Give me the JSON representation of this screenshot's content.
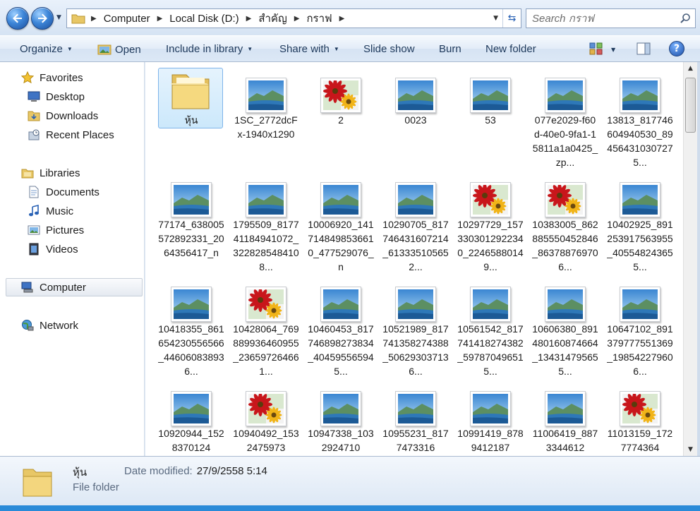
{
  "navigation": {
    "breadcrumbs": [
      "Computer",
      "Local Disk (D:)",
      "สำคัญ",
      "กราฟ"
    ],
    "search_placeholder": "Search กราฟ"
  },
  "toolbar": {
    "organize": "Organize",
    "open": "Open",
    "include_in_library": "Include in library",
    "share_with": "Share with",
    "slide_show": "Slide show",
    "burn": "Burn",
    "new_folder": "New folder",
    "help": "?"
  },
  "sidebar": {
    "favorites": "Favorites",
    "desktop": "Desktop",
    "downloads": "Downloads",
    "recent_places": "Recent Places",
    "libraries": "Libraries",
    "documents": "Documents",
    "music": "Music",
    "pictures": "Pictures",
    "videos": "Videos",
    "computer": "Computer",
    "network": "Network"
  },
  "files": [
    {
      "label": "หุ้น",
      "kind": "folder",
      "selected": true
    },
    {
      "label": "1SC_2772dcFx-1940x1290",
      "kind": "landscape"
    },
    {
      "label": "2",
      "kind": "flower"
    },
    {
      "label": "0023",
      "kind": "landscape"
    },
    {
      "label": "53",
      "kind": "landscape"
    },
    {
      "label": "077e2029-f60d-40e0-9fa1-15811a1a0425_zp...",
      "kind": "landscape"
    },
    {
      "label": "13813_817746604940530_894564310307275...",
      "kind": "landscape"
    },
    {
      "label": "77174_638005572892331_2064356417_n",
      "kind": "landscape"
    },
    {
      "label": "1795509_817741184941072_3228285484108...",
      "kind": "landscape"
    },
    {
      "label": "10006920_1417148498536610_477529076_n",
      "kind": "landscape"
    },
    {
      "label": "10290705_817746431607214_613335105652...",
      "kind": "landscape"
    },
    {
      "label": "10297729_1573303012922340_22465880149...",
      "kind": "flower"
    },
    {
      "label": "10383005_862885550452846_863788769706...",
      "kind": "flower"
    },
    {
      "label": "10402925_891253917563955_405548243655...",
      "kind": "landscape"
    },
    {
      "label": "10418355_861654230556566_446060838936...",
      "kind": "landscape"
    },
    {
      "label": "10428064_769889936460955_236597264661...",
      "kind": "flower"
    },
    {
      "label": "10460453_817746898273834_404595565945...",
      "kind": "landscape"
    },
    {
      "label": "10521989_817741358274388_506293037136...",
      "kind": "landscape"
    },
    {
      "label": "10561542_817741418274382_597870496515...",
      "kind": "landscape"
    },
    {
      "label": "10606380_891480160874664_134314795655...",
      "kind": "landscape"
    },
    {
      "label": "10647102_891379777551369_198542279606...",
      "kind": "landscape"
    },
    {
      "label": "10920944_1528370124",
      "kind": "landscape"
    },
    {
      "label": "10940492_1532475973",
      "kind": "flower"
    },
    {
      "label": "10947338_1032924710",
      "kind": "landscape"
    },
    {
      "label": "10955231_8177473316",
      "kind": "landscape"
    },
    {
      "label": "10991419_8789412187",
      "kind": "landscape"
    },
    {
      "label": "11006419_8873344612",
      "kind": "landscape"
    },
    {
      "label": "11013159_1727774364",
      "kind": "flower"
    }
  ],
  "details": {
    "name": "หุ้น",
    "type": "File folder",
    "modified_label": "Date modified:",
    "modified_value": "27/9/2558 5:14"
  }
}
